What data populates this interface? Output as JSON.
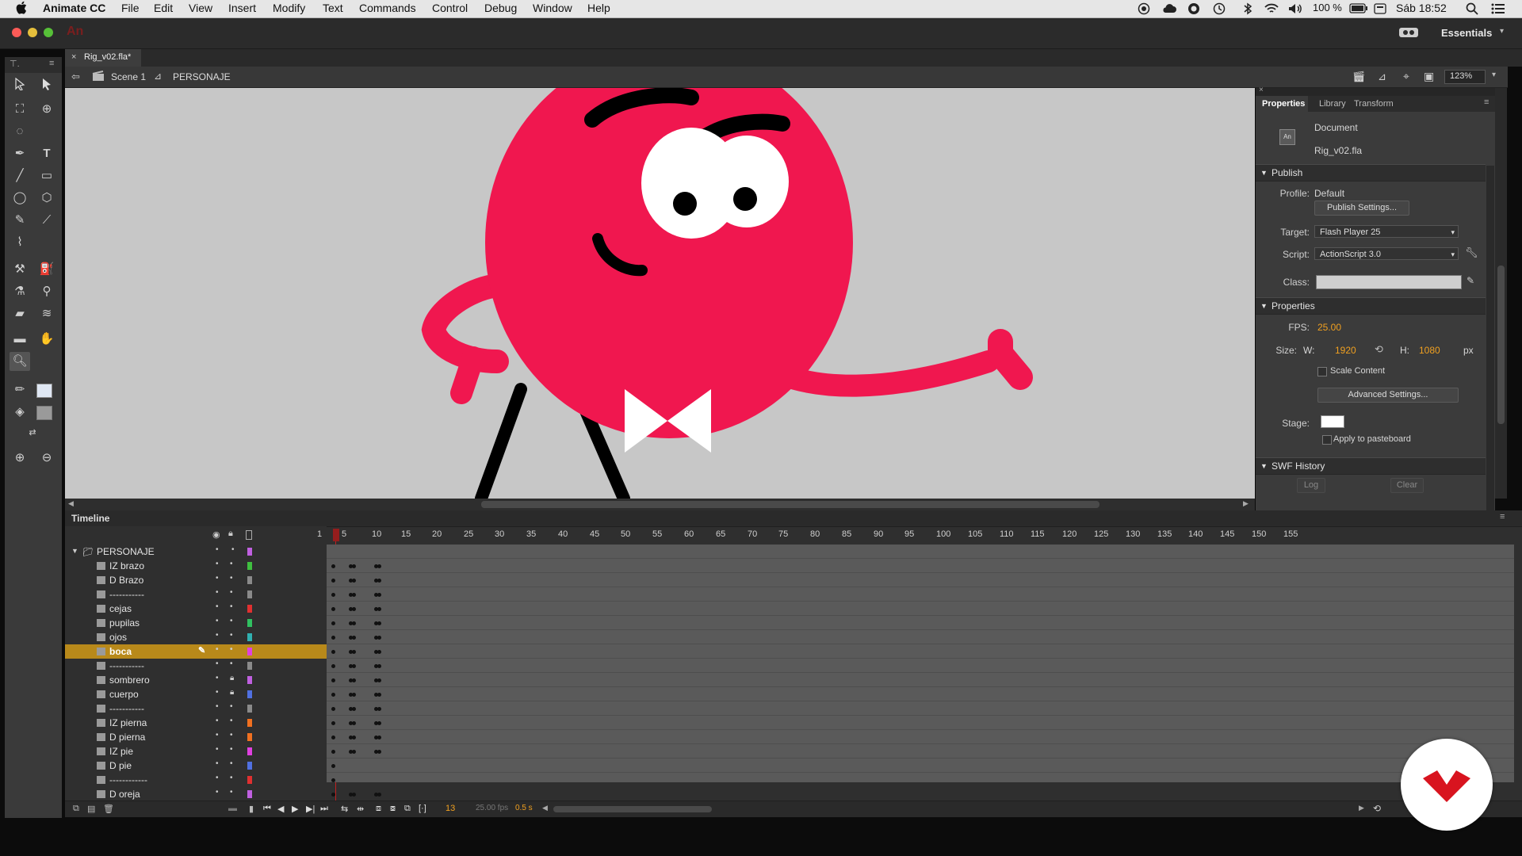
{
  "menubar": {
    "apple": "",
    "app_name": "Animate CC",
    "items": [
      "File",
      "Edit",
      "View",
      "Insert",
      "Modify",
      "Text",
      "Commands",
      "Control",
      "Debug",
      "Window",
      "Help"
    ],
    "battery": "100 %",
    "clock": "Sáb 18:52"
  },
  "titlebar": {
    "app_logo": "An",
    "workspace": "Essentials"
  },
  "document": {
    "tab": "Rig_v02.fla*",
    "scene": "Scene 1",
    "symbol": "PERSONAJE",
    "zoom": "123%"
  },
  "properties": {
    "tabs": [
      "Properties",
      "Library",
      "Transform"
    ],
    "doc_type": "Document",
    "doc_name": "Rig_v02.fla",
    "publish": {
      "header": "Publish",
      "profile_label": "Profile:",
      "profile_value": "Default",
      "publish_settings": "Publish Settings...",
      "target_label": "Target:",
      "target_value": "Flash Player 25",
      "script_label": "Script:",
      "script_value": "ActionScript 3.0",
      "class_label": "Class:"
    },
    "props": {
      "header": "Properties",
      "fps_label": "FPS:",
      "fps_value": "25.00",
      "size_label": "Size:",
      "w_label": "W:",
      "w_value": "1920",
      "h_label": "H:",
      "h_value": "1080",
      "unit": "px",
      "scale_content": "Scale Content",
      "advanced": "Advanced Settings...",
      "stage_label": "Stage:",
      "stage_color": "#ffffff",
      "apply_pasteboard": "Apply to pasteboard"
    },
    "swf": {
      "header": "SWF History",
      "log": "Log",
      "clear": "Clear"
    }
  },
  "timeline": {
    "title": "Timeline",
    "ruler": [
      "1",
      "5",
      "10",
      "15",
      "20",
      "25",
      "30",
      "35",
      "40",
      "45",
      "50",
      "55",
      "60",
      "65",
      "70",
      "75",
      "80",
      "85",
      "90",
      "95",
      "100",
      "105",
      "110",
      "115",
      "120",
      "125",
      "130",
      "135",
      "140",
      "145",
      "150",
      "155"
    ],
    "folder": "PERSONAJE",
    "layers": [
      {
        "name": "IZ brazo",
        "color": "#3fbf3f"
      },
      {
        "name": "D Brazo",
        "color": "#8a8a8a"
      },
      {
        "name": "-----------",
        "color": "#8a8a8a"
      },
      {
        "name": "cejas",
        "color": "#e03030"
      },
      {
        "name": "pupilas",
        "color": "#30c060"
      },
      {
        "name": "ojos",
        "color": "#30b0b0"
      },
      {
        "name": "boca",
        "color": "#e040e0",
        "selected": true
      },
      {
        "name": "-----------",
        "color": "#8a8a8a"
      },
      {
        "name": "sombrero",
        "color": "#c060e0",
        "locked": true
      },
      {
        "name": "cuerpo",
        "color": "#5070e0",
        "locked": true
      },
      {
        "name": "-----------",
        "color": "#8a8a8a"
      },
      {
        "name": "IZ pierna",
        "color": "#f07020"
      },
      {
        "name": "D pierna",
        "color": "#f07020"
      },
      {
        "name": "IZ pie",
        "color": "#e040e0"
      },
      {
        "name": "D pie",
        "color": "#5070e0"
      },
      {
        "name": "------------",
        "color": "#e03030"
      },
      {
        "name": "D oreja",
        "color": "#c060e0"
      }
    ],
    "current_frame": "13",
    "fps": "25.00 fps",
    "time": "0.5 s"
  },
  "colors": {
    "character": "#f0174f",
    "stage_bg": "#c7c7c7",
    "selected_layer": "#b8891a"
  }
}
